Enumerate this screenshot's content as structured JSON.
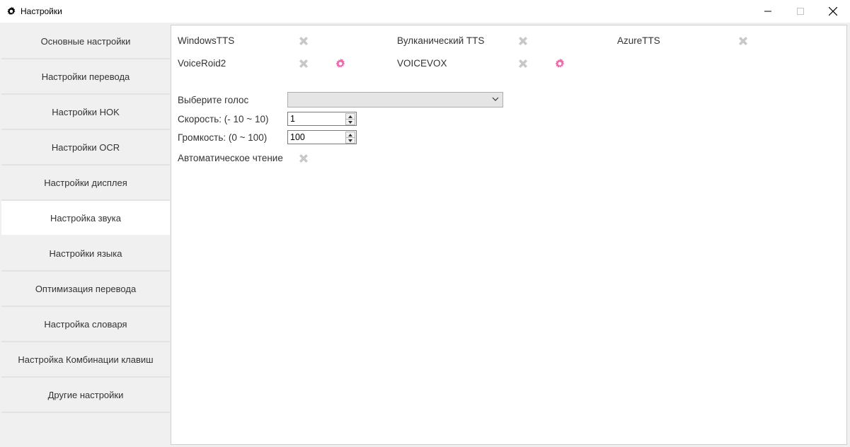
{
  "window": {
    "title": "Настройки",
    "controls": {
      "minimize": "minimize-icon",
      "maximize": "maximize-icon",
      "close": "close-icon"
    }
  },
  "sidebar": {
    "items": [
      {
        "label": "Основные настройки",
        "active": false
      },
      {
        "label": "Настройки перевода",
        "active": false
      },
      {
        "label": "Настройки HOK",
        "active": false
      },
      {
        "label": "Настройки OCR",
        "active": false
      },
      {
        "label": "Настройки дисплея",
        "active": false
      },
      {
        "label": "Настройка звука",
        "active": true
      },
      {
        "label": "Настройки языка",
        "active": false
      },
      {
        "label": "Оптимизация перевода",
        "active": false
      },
      {
        "label": "Настройка словаря",
        "active": false
      },
      {
        "label": "Настройка Комбинации клавиш",
        "active": false
      },
      {
        "label": "Другие настройки",
        "active": false
      }
    ]
  },
  "engines": [
    {
      "name": "WindowsTTS",
      "enabled": false,
      "has_settings": false
    },
    {
      "name": "Вулканический TTS",
      "enabled": false,
      "has_settings": false
    },
    {
      "name": "AzureTTS",
      "enabled": false,
      "has_settings": false
    },
    {
      "name": "VoiceRoid2",
      "enabled": false,
      "has_settings": true
    },
    {
      "name": "VOICEVOX",
      "enabled": false,
      "has_settings": true
    }
  ],
  "voice": {
    "label": "Выберите голос",
    "value": ""
  },
  "speed": {
    "label": "Скорость: (- 10 ~ 10)",
    "value": "1"
  },
  "volume": {
    "label": "Громкость: (0 ~ 100)",
    "value": "100"
  },
  "auto_read": {
    "label": "Автоматическое чтение",
    "enabled": false
  },
  "colors": {
    "accent_gear": "#f06aae",
    "disabled_x": "#c8c8c8",
    "active_bg": "#ffffff"
  }
}
